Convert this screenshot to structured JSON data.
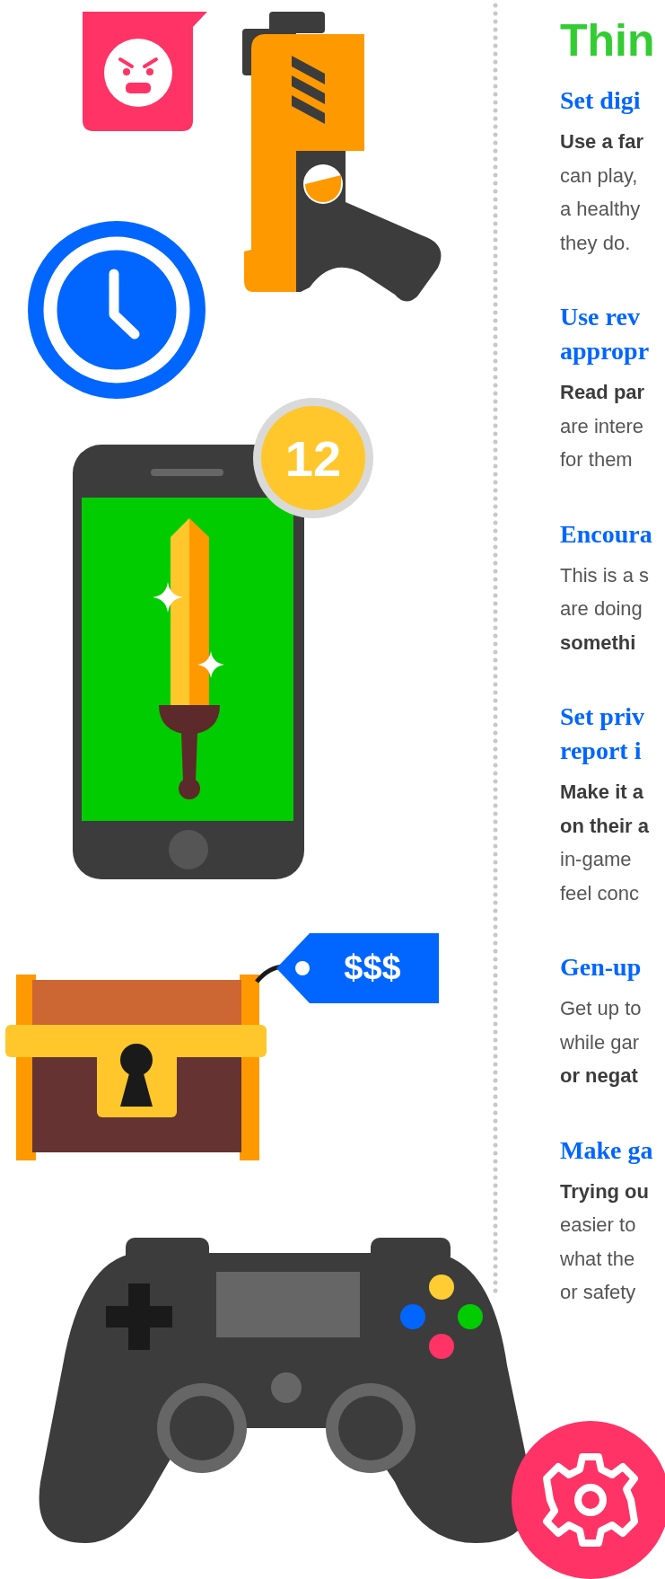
{
  "title": "Thin",
  "art": {
    "age_badge": "12",
    "price_tag": "$$$"
  },
  "sections": [
    {
      "heading": [
        "Set digi"
      ],
      "lines": [
        {
          "text": "Use a far",
          "kind": "bold"
        },
        {
          "text": "can play,",
          "kind": "regular"
        },
        {
          "text": "a healthy",
          "kind": "regular"
        },
        {
          "text": "they do.",
          "kind": "regular"
        }
      ]
    },
    {
      "heading": [
        "Use rev",
        "appropr"
      ],
      "lines": [
        {
          "text": "Read par",
          "kind": "bold"
        },
        {
          "text": "are intere",
          "kind": "regular"
        },
        {
          "text": "for them",
          "kind": "regular"
        }
      ]
    },
    {
      "heading": [
        "Encoura"
      ],
      "lines": [
        {
          "text": "This is a s",
          "kind": "regular"
        },
        {
          "text": "are doing",
          "kind": "regular"
        },
        {
          "text": "somethi",
          "kind": "bold"
        }
      ]
    },
    {
      "heading": [
        "Set priv",
        "report i"
      ],
      "lines": [
        {
          "text": "Make it a",
          "kind": "bold"
        },
        {
          "text": "on their a",
          "kind": "bold"
        },
        {
          "text": "in-game",
          "kind": "regular"
        },
        {
          "text": "feel conc",
          "kind": "regular"
        }
      ]
    },
    {
      "heading": [
        "Gen-up"
      ],
      "lines": [
        {
          "text": "Get up to",
          "kind": "regular"
        },
        {
          "text": "while gar",
          "kind": "regular"
        },
        {
          "text": "or negat",
          "kind": "bold"
        }
      ]
    },
    {
      "heading": [
        "Make ga"
      ],
      "lines": [
        {
          "text": "Trying ou",
          "kind": "bold"
        },
        {
          "text": "easier to",
          "kind": "regular"
        },
        {
          "text": "what the",
          "kind": "regular"
        },
        {
          "text": "or safety",
          "kind": "regular"
        }
      ]
    }
  ]
}
